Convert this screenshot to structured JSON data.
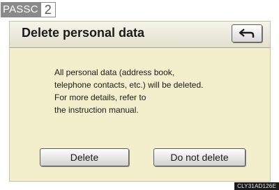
{
  "tag": {
    "label": "PASSC",
    "number": "2"
  },
  "screen": {
    "title": "Delete personal data",
    "back_icon": "back-arrow-icon",
    "message": "All personal data (address book,\ntelephone contacts, etc.) will be deleted.\nFor more details, refer to\nthe instruction manual.",
    "buttons": {
      "delete": "Delete",
      "keep": "Do not delete"
    }
  },
  "image_code": "CLY31AD126E",
  "colors": {
    "screen_bg": "#f3eecb",
    "header_bg": "#e9e7d6",
    "tag_bg": "#8a8a8a",
    "code_bg": "#1a1a1a"
  }
}
